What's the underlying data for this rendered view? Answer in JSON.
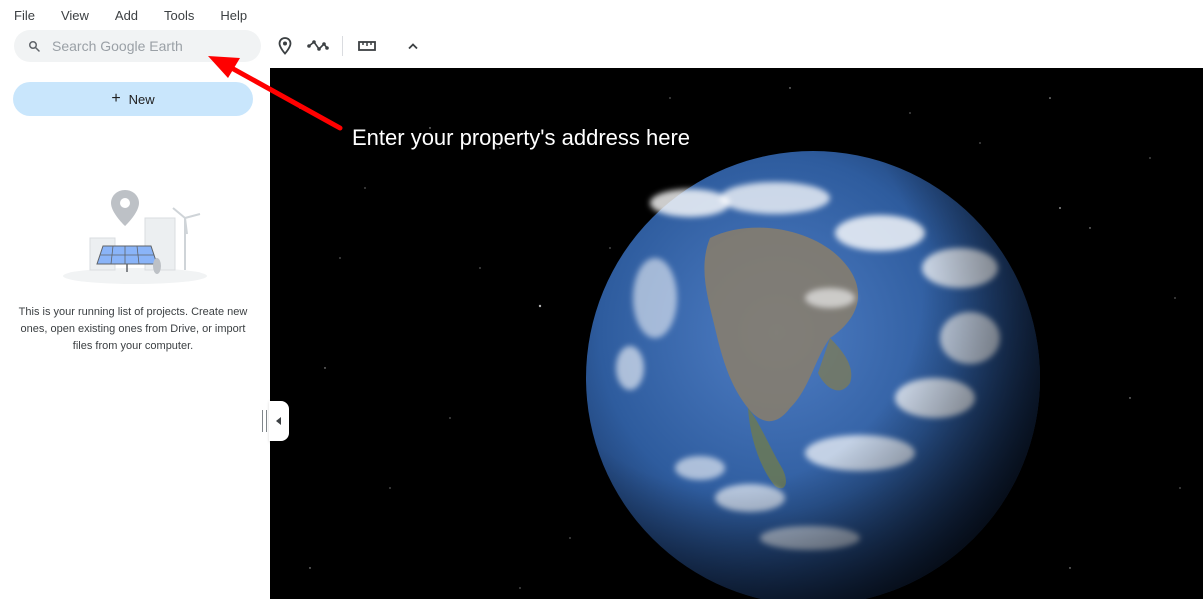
{
  "menu": [
    "File",
    "View",
    "Add",
    "Tools",
    "Help"
  ],
  "search": {
    "placeholder": "Search Google Earth",
    "value": ""
  },
  "toolbar": {
    "icons": [
      "place-marker-icon",
      "draw-line-icon",
      "ruler-icon",
      "chevron-up-icon"
    ]
  },
  "sidebar": {
    "new_label": "New",
    "empty_text": "This is your running list of projects. Create new ones, open existing ones from Drive, or import files from your computer."
  },
  "annotation": {
    "text": "Enter your property's address here",
    "arrow_color": "#ff0000"
  },
  "colors": {
    "new_button": "#c9e6fc",
    "space": "#000000"
  }
}
